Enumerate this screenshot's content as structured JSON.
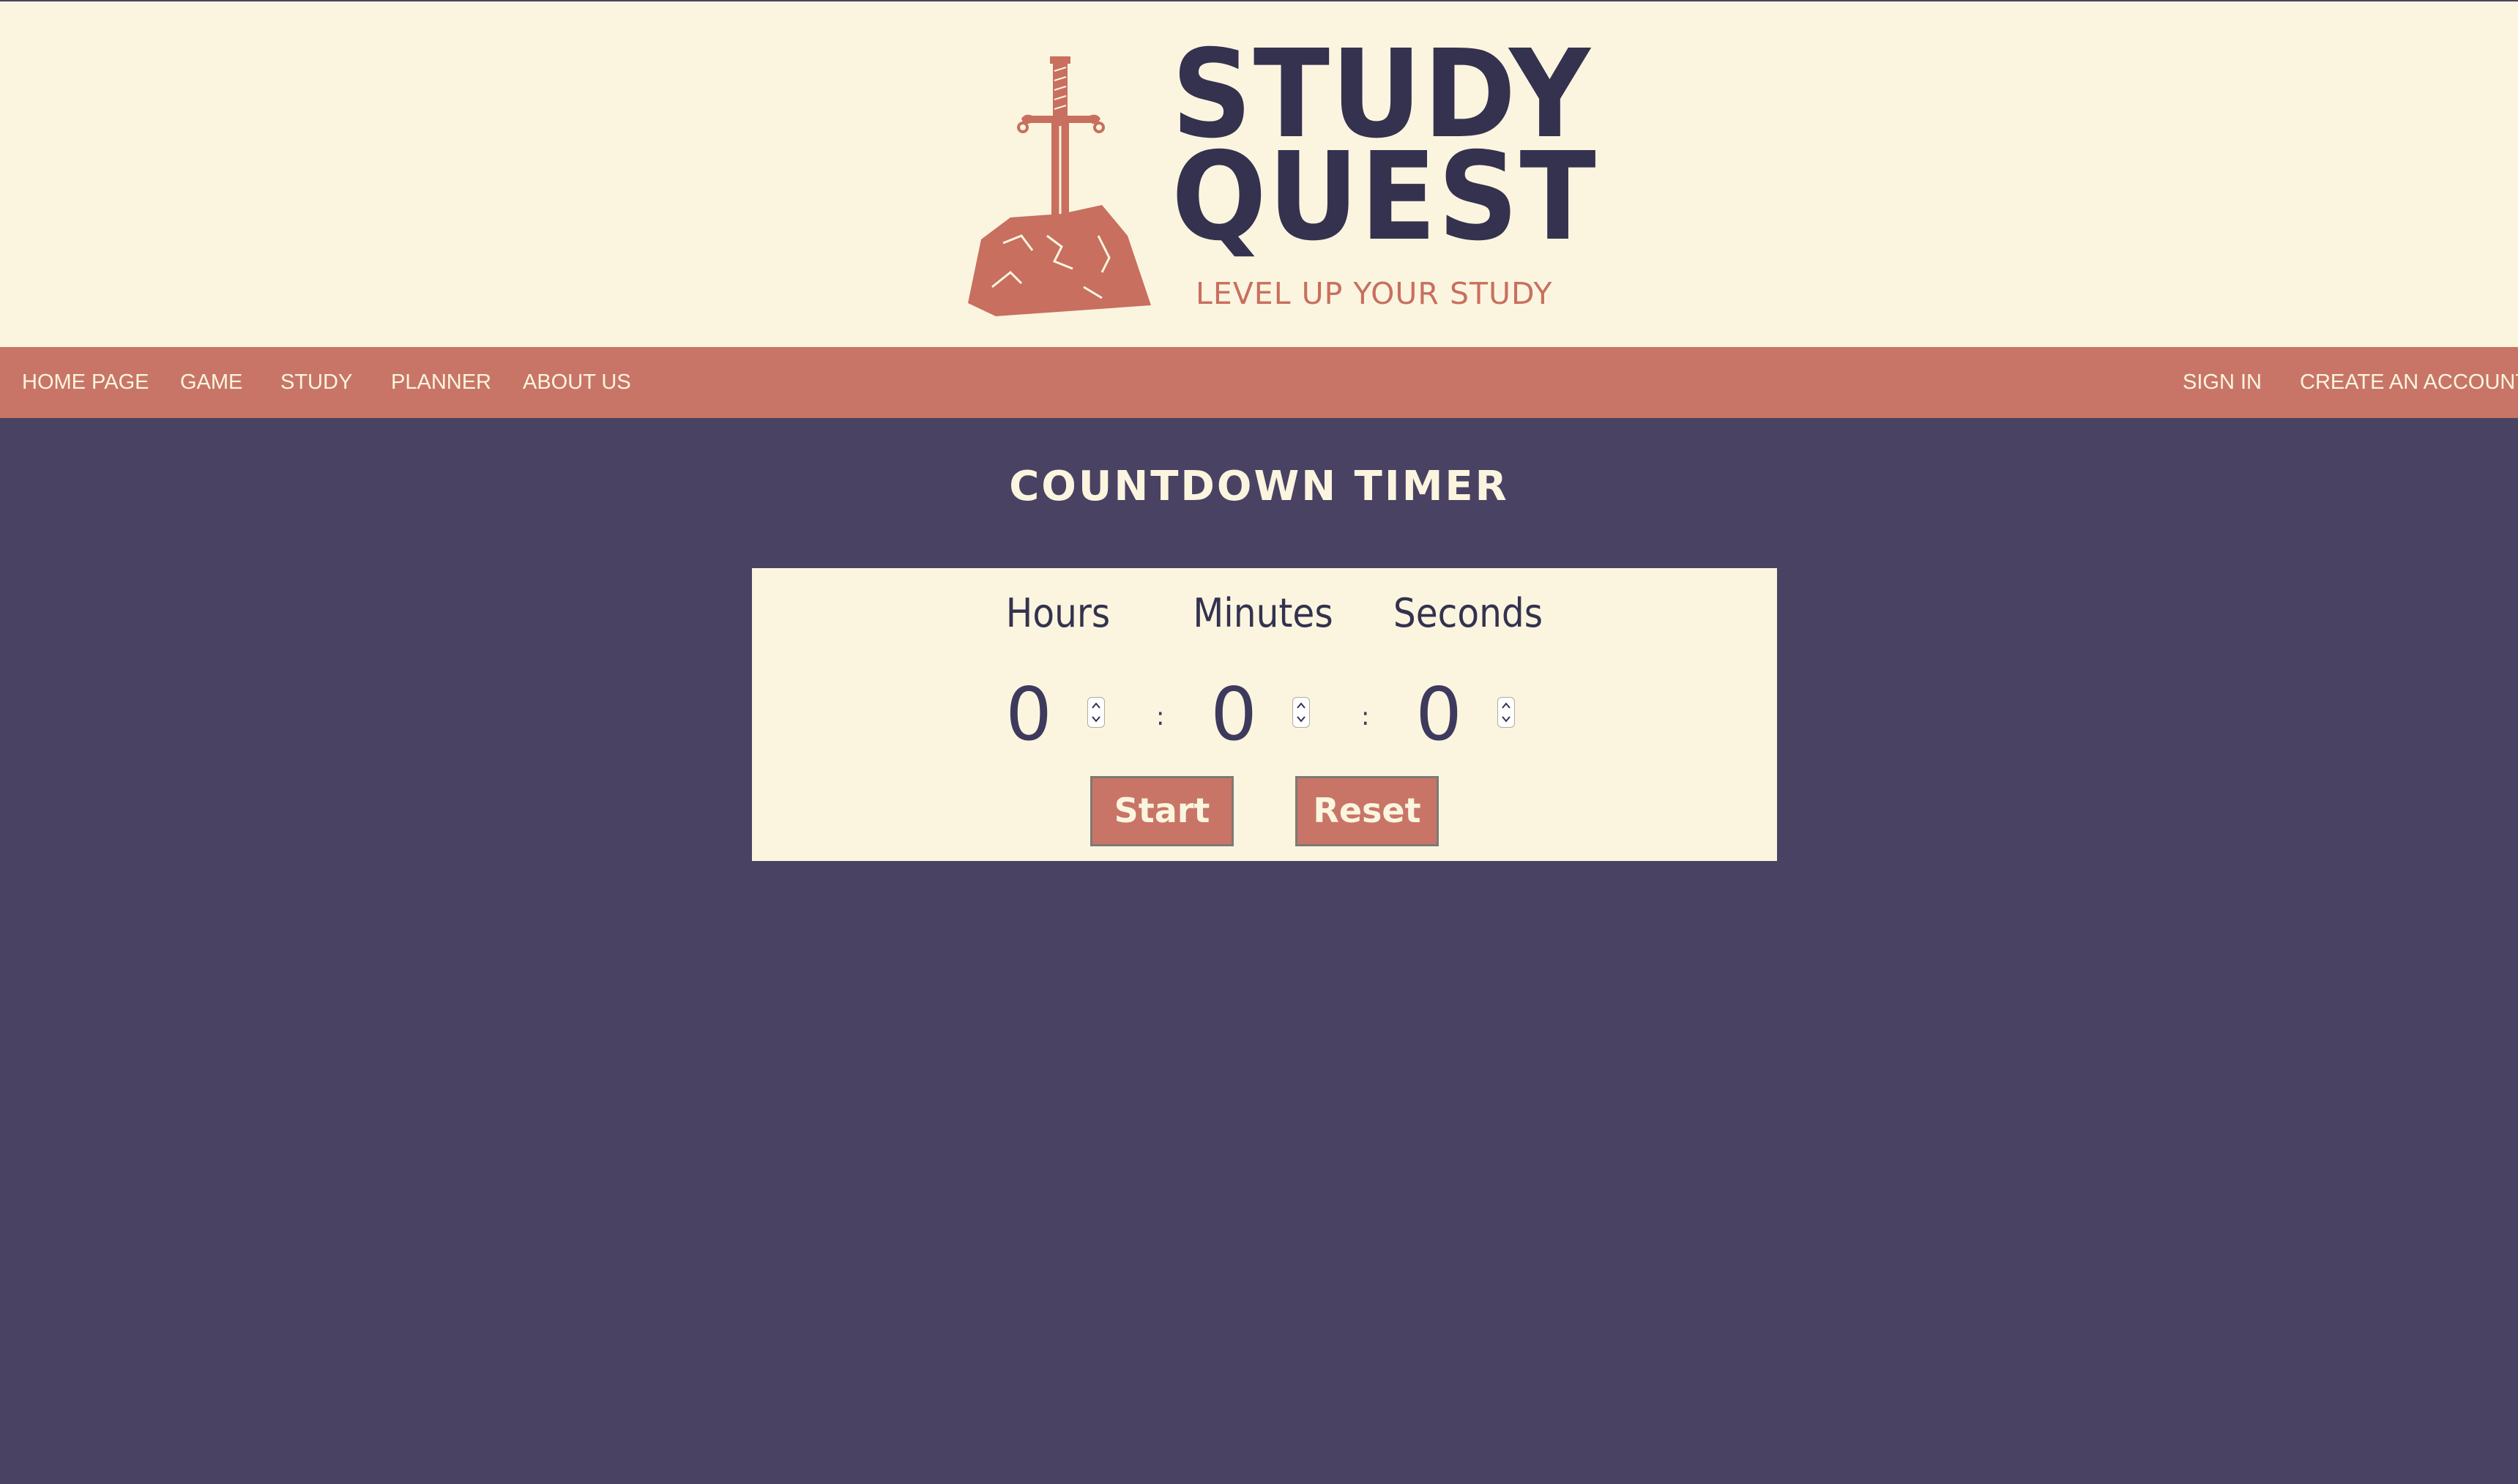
{
  "brand": {
    "title_line1": "STUDY",
    "title_line2": "QUEST",
    "tagline": "LEVEL UP YOUR STUDY"
  },
  "nav": {
    "left": [
      "HOME PAGE",
      "GAME",
      "STUDY",
      "PLANNER",
      "ABOUT US"
    ],
    "right": [
      "SIGN IN",
      "CREATE AN ACCOUNT"
    ]
  },
  "page": {
    "title": "COUNTDOWN TIMER"
  },
  "timer": {
    "labels": {
      "hours": "Hours",
      "minutes": "Minutes",
      "seconds": "Seconds"
    },
    "values": {
      "hours": "0",
      "minutes": "0",
      "seconds": "0"
    },
    "separator": ":",
    "start_label": "Start",
    "reset_label": "Reset"
  },
  "colors": {
    "background": "#4a4263",
    "header_bg": "#fbf5df",
    "nav_bg": "#c87567",
    "accent": "#c87567",
    "text_dark": "#34324f"
  }
}
